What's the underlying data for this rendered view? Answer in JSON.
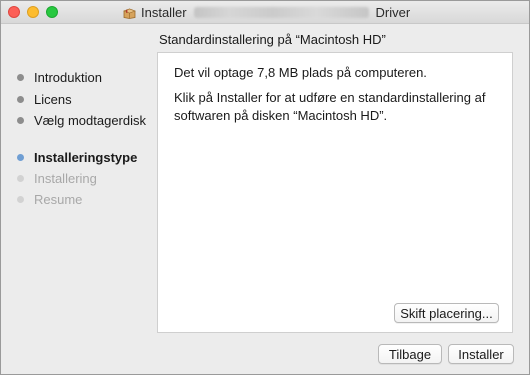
{
  "window": {
    "title_prefix": "Installer",
    "title_suffix": "Driver",
    "app_icon": "package-icon"
  },
  "panel_heading": "Standardinstallering på “Macintosh HD”",
  "steps": [
    {
      "label": "Introduktion",
      "state": "done"
    },
    {
      "label": "Licens",
      "state": "done"
    },
    {
      "label": "Vælg modtagerdisk",
      "state": "done"
    },
    {
      "label": "Installeringstype",
      "state": "current"
    },
    {
      "label": "Installering",
      "state": "future"
    },
    {
      "label": "Resume",
      "state": "future"
    }
  ],
  "content": {
    "line1": "Det vil optage 7,8 MB plads på computeren.",
    "line2": "Klik på Installer for at udføre en standardinstallering af softwaren på disken “Macintosh HD”."
  },
  "buttons": {
    "change_location": "Skift placering...",
    "back": "Tilbage",
    "install": "Installer"
  },
  "colors": {
    "step_current_dot": "#6f9ed3",
    "close": "#fc5f57",
    "minimize": "#fdbc2e",
    "zoom": "#28c840"
  }
}
